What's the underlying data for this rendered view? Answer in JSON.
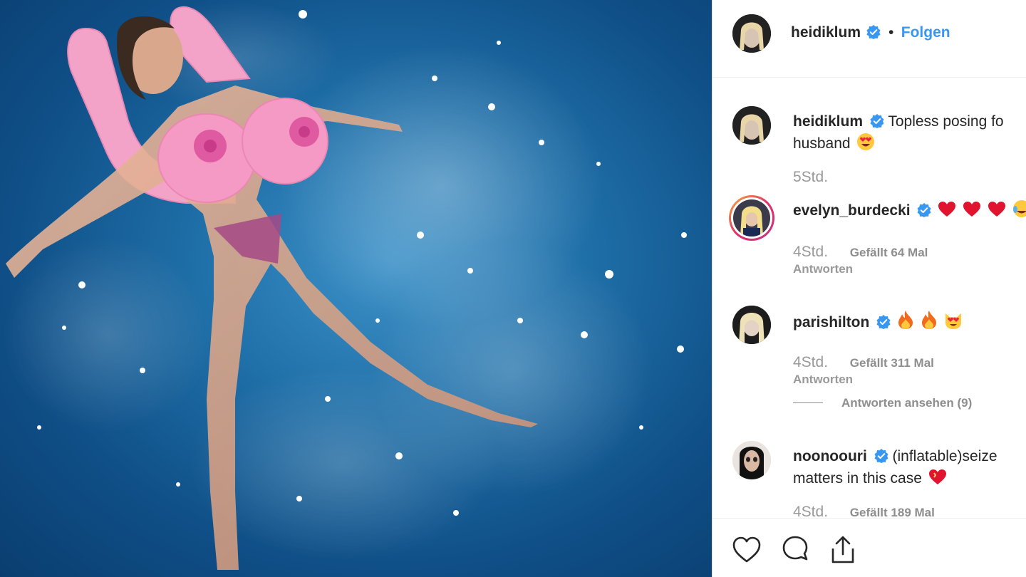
{
  "post": {
    "author": "heidiklum",
    "follow_label": "Folgen",
    "separator": "•"
  },
  "caption": {
    "username": "heidiklum",
    "text_line1": "Topless posing fo",
    "text_line2": "husband",
    "time": "5Std."
  },
  "comments": [
    {
      "username": "evelyn_burdecki",
      "time": "4Std.",
      "likes": "Gefällt 64 Mal",
      "reply": "Antworten"
    },
    {
      "username": "parishilton",
      "time": "4Std.",
      "likes": "Gefällt 311 Mal",
      "reply": "Antworten",
      "view_replies": "Antworten ansehen (9)"
    },
    {
      "username": "noonoouri",
      "text_line1": "(inflatable)seize",
      "text_line2": "matters in this case",
      "time": "4Std.",
      "likes": "Gefällt 189 Mal"
    }
  ],
  "icons": [
    "verified-badge-icon",
    "heart-icon",
    "comment-icon",
    "share-icon",
    "heart-emoji",
    "fire-emoji",
    "heart-eyes-emoji"
  ],
  "colors": {
    "accent": "#3897f0",
    "username": "#262626",
    "meta": "#8e8e8e"
  }
}
